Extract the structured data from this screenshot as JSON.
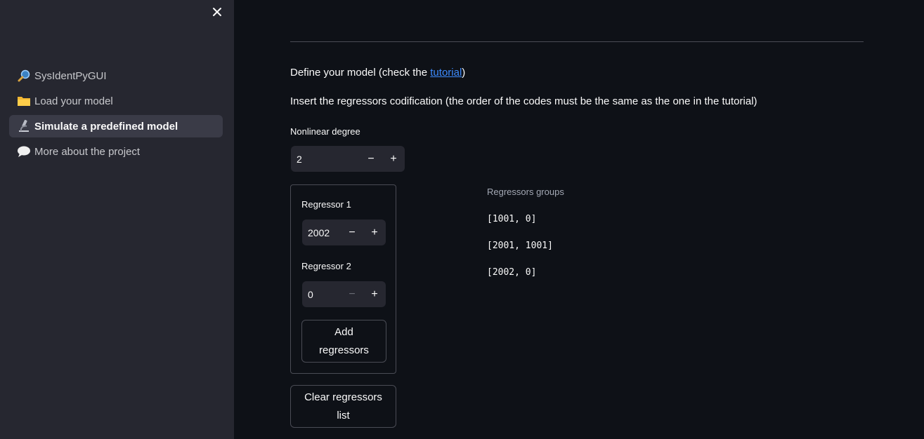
{
  "sidebar": {
    "close_icon": "close-icon",
    "items": [
      {
        "label": "SysIdentPyGUI",
        "icon": "magnifier-icon",
        "active": false
      },
      {
        "label": "Load your model",
        "icon": "folder-icon",
        "active": false
      },
      {
        "label": "Simulate a predefined model",
        "icon": "microscope-icon",
        "active": true
      },
      {
        "label": "More about the project",
        "icon": "speech-bubble-icon",
        "active": false
      }
    ]
  },
  "main": {
    "define_prefix": "Define your model (check the ",
    "tutorial_link": "tutorial",
    "define_suffix": ")",
    "insert_text": "Insert the regressors codification (the order of the codes must be the same as the one in the tutorial)",
    "nonlinear_label": "Nonlinear degree",
    "nonlinear_value": "2",
    "regressor1_label": "Regressor 1",
    "regressor1_value": "2002",
    "regressor2_label": "Regressor 2",
    "regressor2_value": "0",
    "minus": "−",
    "plus": "+",
    "add_button": "Add regressors",
    "clear_button": "Clear regressors list",
    "groups_title": "Regressors groups",
    "groups": [
      "[1001, 0]",
      "[2001, 1001]",
      "[2002, 0]"
    ]
  },
  "colors": {
    "background": "#0e1117",
    "sidebar": "#262730",
    "link": "#3d8bfd"
  }
}
